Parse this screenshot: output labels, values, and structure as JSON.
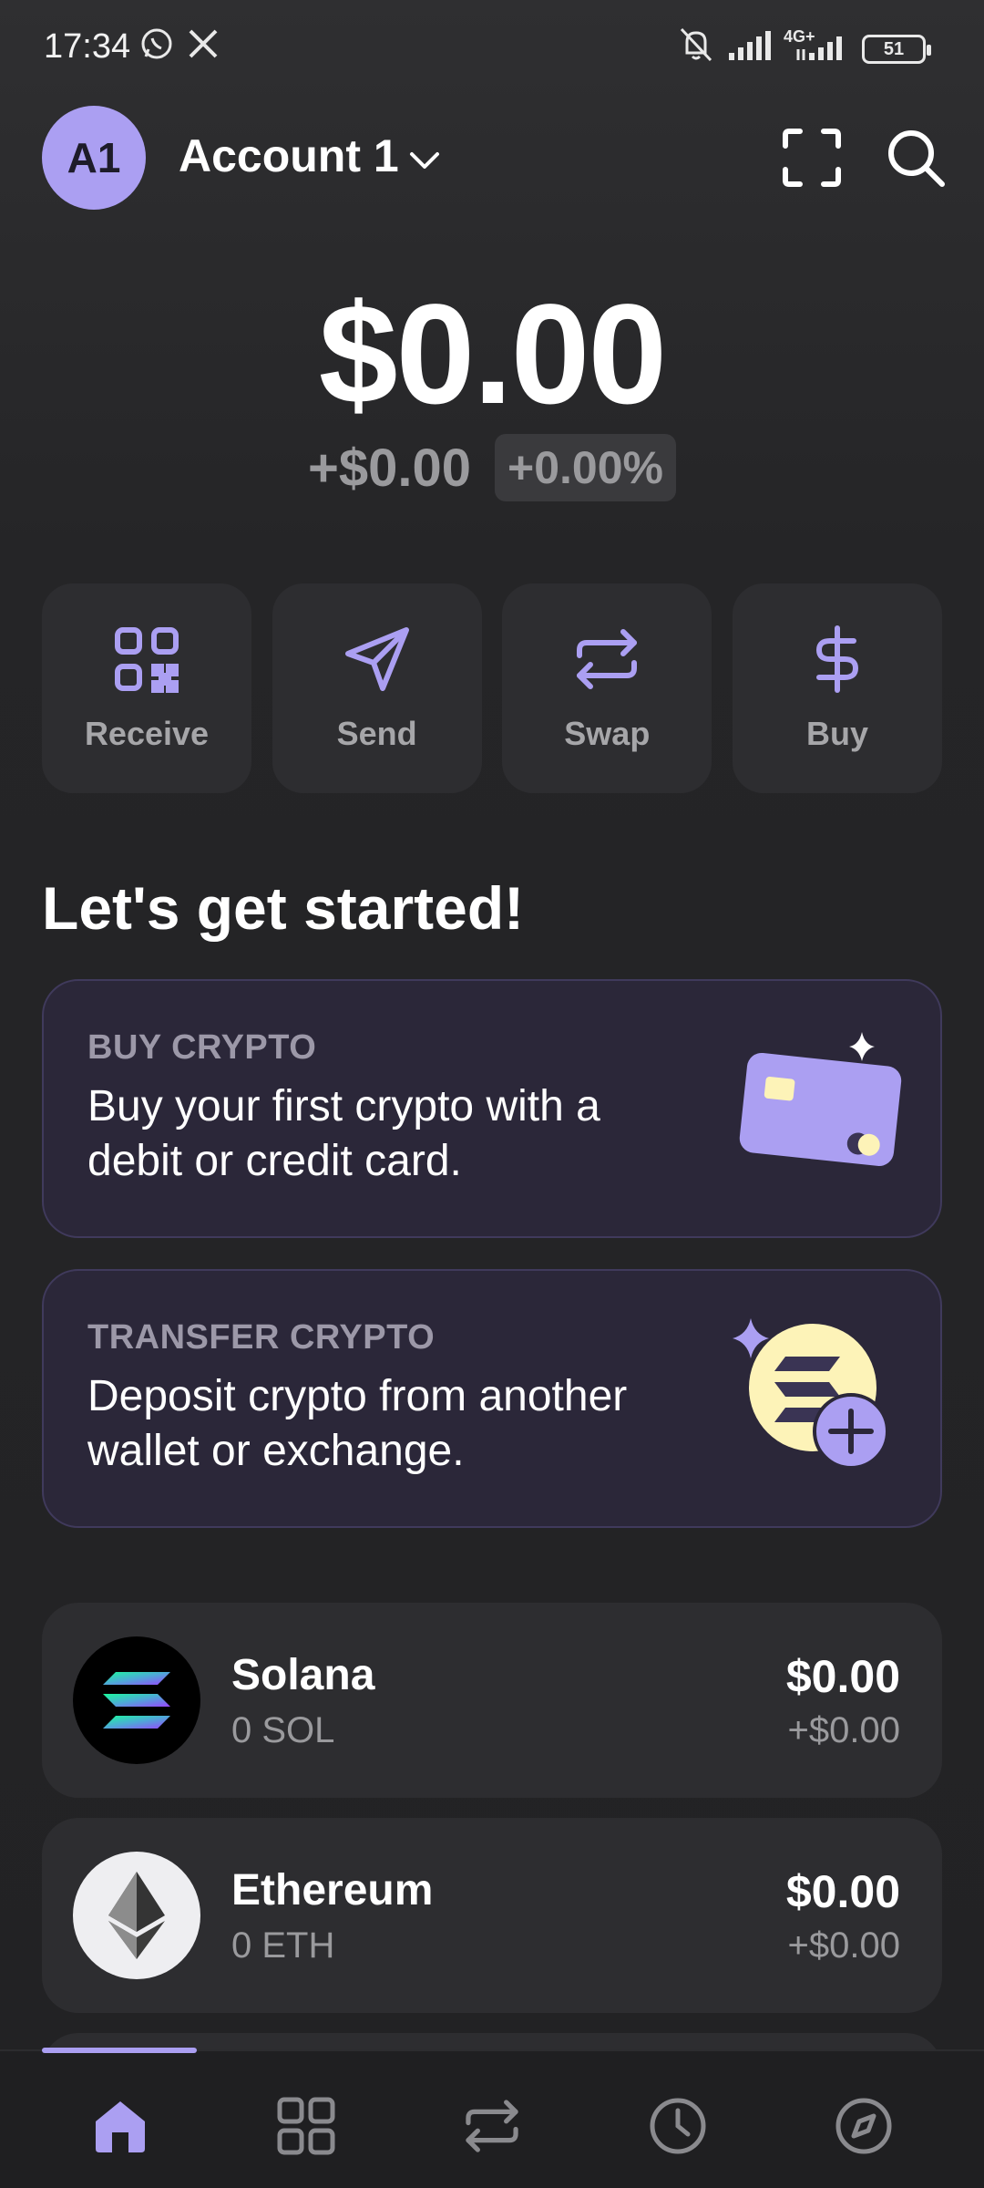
{
  "status_bar": {
    "time": "17:34",
    "network_label": "4G+",
    "battery": "51"
  },
  "header": {
    "avatar_initials": "A1",
    "account_name": "Account 1"
  },
  "balance": {
    "total": "$0.00",
    "change_abs": "+$0.00",
    "change_pct": "+0.00%"
  },
  "actions": [
    {
      "label": "Receive",
      "icon": "qr-code-icon"
    },
    {
      "label": "Send",
      "icon": "send-icon"
    },
    {
      "label": "Swap",
      "icon": "swap-icon"
    },
    {
      "label": "Buy",
      "icon": "dollar-icon"
    }
  ],
  "get_started": {
    "title": "Let's get started!",
    "cards": [
      {
        "kicker": "BUY CRYPTO",
        "text": "Buy your first crypto with a debit or credit card."
      },
      {
        "kicker": "TRANSFER CRYPTO",
        "text": "Deposit crypto from another wallet or exchange."
      }
    ]
  },
  "tokens": [
    {
      "name": "Solana",
      "amount": "0 SOL",
      "value": "$0.00",
      "change": "+$0.00"
    },
    {
      "name": "Ethereum",
      "amount": "0 ETH",
      "value": "$0.00",
      "change": "+$0.00"
    }
  ],
  "bottom_nav": [
    "home-icon",
    "grid-icon",
    "swap-icon",
    "history-icon",
    "explore-icon"
  ],
  "colors": {
    "accent": "#ab9ff2",
    "card": "#2d2d30",
    "promo_card": "#2b2739"
  }
}
